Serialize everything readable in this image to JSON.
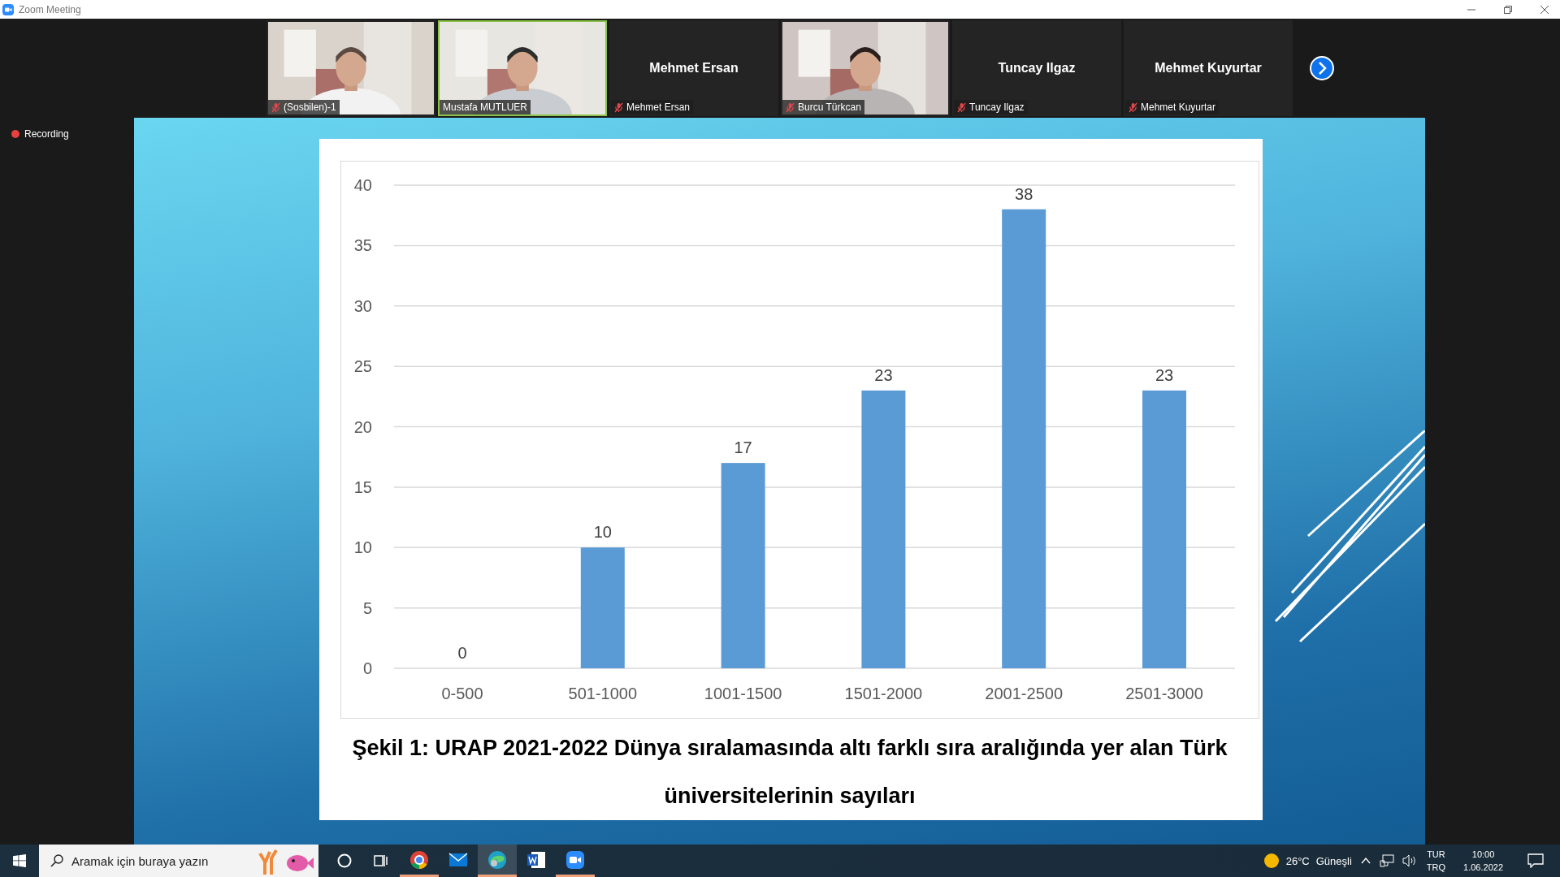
{
  "window": {
    "title": "Zoom Meeting"
  },
  "participants": [
    {
      "kind": "video",
      "name": "(Sosbilen)-1",
      "muted": true,
      "active": false
    },
    {
      "kind": "video",
      "name": "Mustafa MUTLUER",
      "muted": false,
      "active": true
    },
    {
      "kind": "name",
      "display": "Mehmet Ersan",
      "name": "Mehmet Ersan",
      "muted": true,
      "active": false
    },
    {
      "kind": "video",
      "name": "Burcu Türkcan",
      "muted": true,
      "active": false
    },
    {
      "kind": "name",
      "display": "Tuncay Ilgaz",
      "name": "Tuncay Ilgaz",
      "muted": true,
      "active": false
    },
    {
      "kind": "name",
      "display": "Mehmet Kuyurtar",
      "name": "Mehmet Kuyurtar",
      "muted": true,
      "active": false
    }
  ],
  "recording": {
    "label": "Recording"
  },
  "slide": {
    "chart_data": {
      "type": "bar",
      "categories": [
        "0-500",
        "501-1000",
        "1001-1500",
        "1501-2000",
        "2001-2500",
        "2501-3000"
      ],
      "values": [
        0,
        10,
        17,
        23,
        38,
        23
      ],
      "ylim": [
        0,
        40
      ],
      "yticks": [
        0,
        5,
        10,
        15,
        20,
        25,
        30,
        35,
        40
      ],
      "data_labels": true,
      "grid": true
    },
    "caption": "Şekil 1: URAP 2021-2022 Dünya sıralamasında altı farklı sıra aralığında yer alan Türk üniversitelerinin sayıları"
  },
  "taskbar": {
    "search": {
      "placeholder": "Aramak için buraya yazın"
    },
    "apps": [
      {
        "kind": "chrome",
        "running": true,
        "selected": false
      },
      {
        "kind": "mail",
        "running": false,
        "selected": false
      },
      {
        "kind": "edge",
        "running": true,
        "selected": true
      },
      {
        "kind": "word",
        "running": false,
        "selected": false
      },
      {
        "kind": "zoom",
        "running": true,
        "selected": false
      }
    ],
    "weather": {
      "temperature": "26°C",
      "condition": "Güneşli"
    },
    "language": [
      "TUR",
      "TRQ"
    ],
    "time": "10:00",
    "date": "1.06.2022"
  }
}
